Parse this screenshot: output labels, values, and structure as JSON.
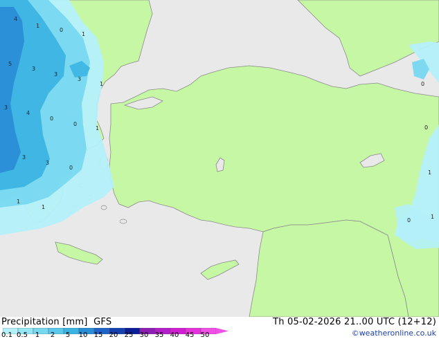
{
  "header": {
    "variable": "Precipitation [mm]",
    "model": "GFS",
    "valid_time": "Th 05-02-2026 21..00 UTC (12+12)",
    "credit": "©weatheronline.co.uk"
  },
  "legend": {
    "labels": [
      "0.1",
      "0.5",
      "1",
      "2",
      "5",
      "10",
      "15",
      "20",
      "25",
      "30",
      "35",
      "40",
      "45",
      "50"
    ],
    "colors": [
      "#b4f0fa",
      "#96e6f6",
      "#78d8f0",
      "#5ac8ea",
      "#3cb4e2",
      "#2a8ed6",
      "#1e64c8",
      "#1440b0",
      "#0a1e96",
      "#8c1eb4",
      "#b41ec8",
      "#d21ed2",
      "#e632dc",
      "#f050e6"
    ]
  },
  "colors": {
    "land": "#c6f7a5",
    "sea": "#e9e9e9",
    "border": "#8a8a8a"
  },
  "map_labels": [
    "4",
    "1",
    "0",
    "1",
    "5",
    "3",
    "3",
    "3",
    "1",
    "3",
    "4",
    "0",
    "0",
    "1",
    "3",
    "3",
    "0",
    "1",
    "1",
    "0",
    "0",
    "1",
    "0",
    "1"
  ]
}
